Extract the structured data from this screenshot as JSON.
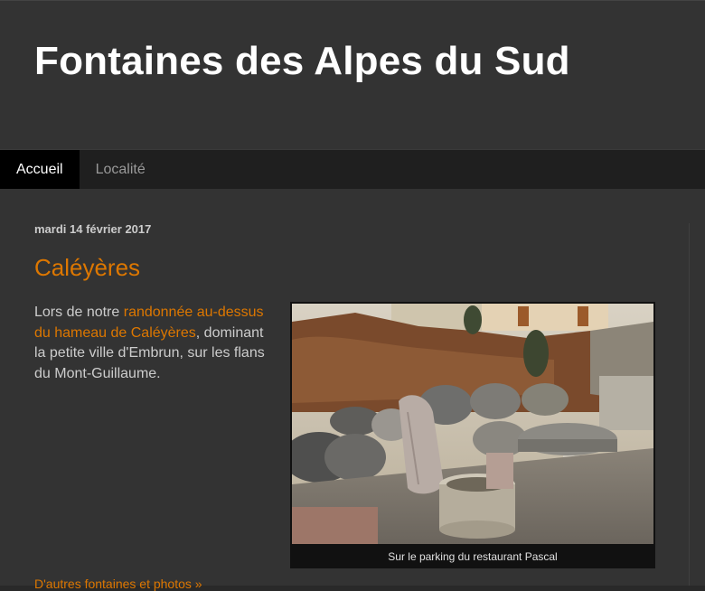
{
  "blog": {
    "title": "Fontaines des Alpes du Sud"
  },
  "tabs": [
    {
      "label": "Accueil",
      "active": true
    },
    {
      "label": "Localité",
      "active": false
    }
  ],
  "post": {
    "date": "mardi 14 février 2017",
    "title": "Caléyères",
    "body_prefix": "Lors de notre ",
    "body_link": "randonnée au-dessus du hameau de Caléyères",
    "body_suffix": ", dominant la petite ville d'Embrun, sur les flans du Mont-Guillaume.",
    "photo_caption": "Sur le parking du restaurant Pascal",
    "more_link": "D'autres fontaines et photos »"
  },
  "colors": {
    "accent": "#dd7700",
    "header_bg": "#333333",
    "tab_active_bg": "#000000",
    "tabs_bg": "#1f1f1f"
  }
}
